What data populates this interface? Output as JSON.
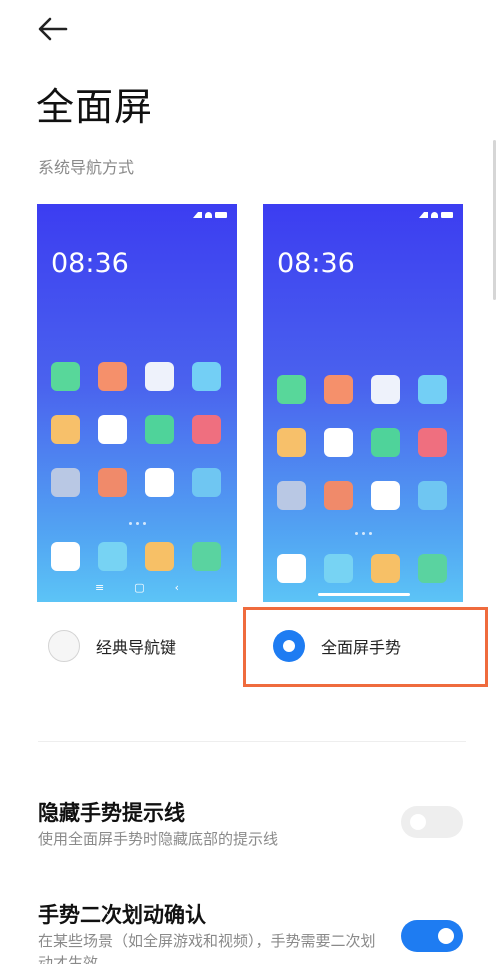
{
  "header": {
    "title": "全面屏",
    "back_icon": "arrow-left-icon"
  },
  "section": {
    "label": "系统导航方式"
  },
  "previews": {
    "classic": {
      "time": "08:36",
      "nav_keys": [
        "≡",
        "▢",
        "‹"
      ],
      "rows": [
        [
          "#58d79a",
          "#f5906b",
          "#eef2fb",
          "#73cff5"
        ],
        [
          "#f7c06a",
          "#ffffff",
          "#4fd39a",
          "#ef6f7f"
        ],
        [
          "#b9c8e4",
          "#f08a6a",
          "#ffffff",
          "#6fc6f2"
        ]
      ],
      "dock": [
        "#ffffff",
        "#77d3f3",
        "#f7c066",
        "#5ad3a0"
      ]
    },
    "gesture": {
      "time": "08:36",
      "rows": [
        [
          "#58d79a",
          "#f5906b",
          "#eef2fb",
          "#73cff5"
        ],
        [
          "#f7c06a",
          "#ffffff",
          "#4fd39a",
          "#ef6f7f"
        ],
        [
          "#b9c8e4",
          "#f08a6a",
          "#ffffff",
          "#6fc6f2"
        ]
      ],
      "dock": [
        "#ffffff",
        "#77d3f3",
        "#f7c066",
        "#5ad3a0"
      ]
    }
  },
  "options": {
    "classic": {
      "label": "经典导航键",
      "selected": false
    },
    "gesture": {
      "label": "全面屏手势",
      "selected": true
    }
  },
  "settings": {
    "hide_hint": {
      "title": "隐藏手势提示线",
      "desc": "使用全面屏手势时隐藏底部的提示线",
      "enabled": false
    },
    "double_swipe": {
      "title": "手势二次划动确认",
      "desc": "在某些场景（如全屏游戏和视频），手势需要二次划动才生效",
      "enabled": true
    }
  },
  "colors": {
    "accent": "#1e7cf2",
    "highlight": "#ef6b3d"
  }
}
